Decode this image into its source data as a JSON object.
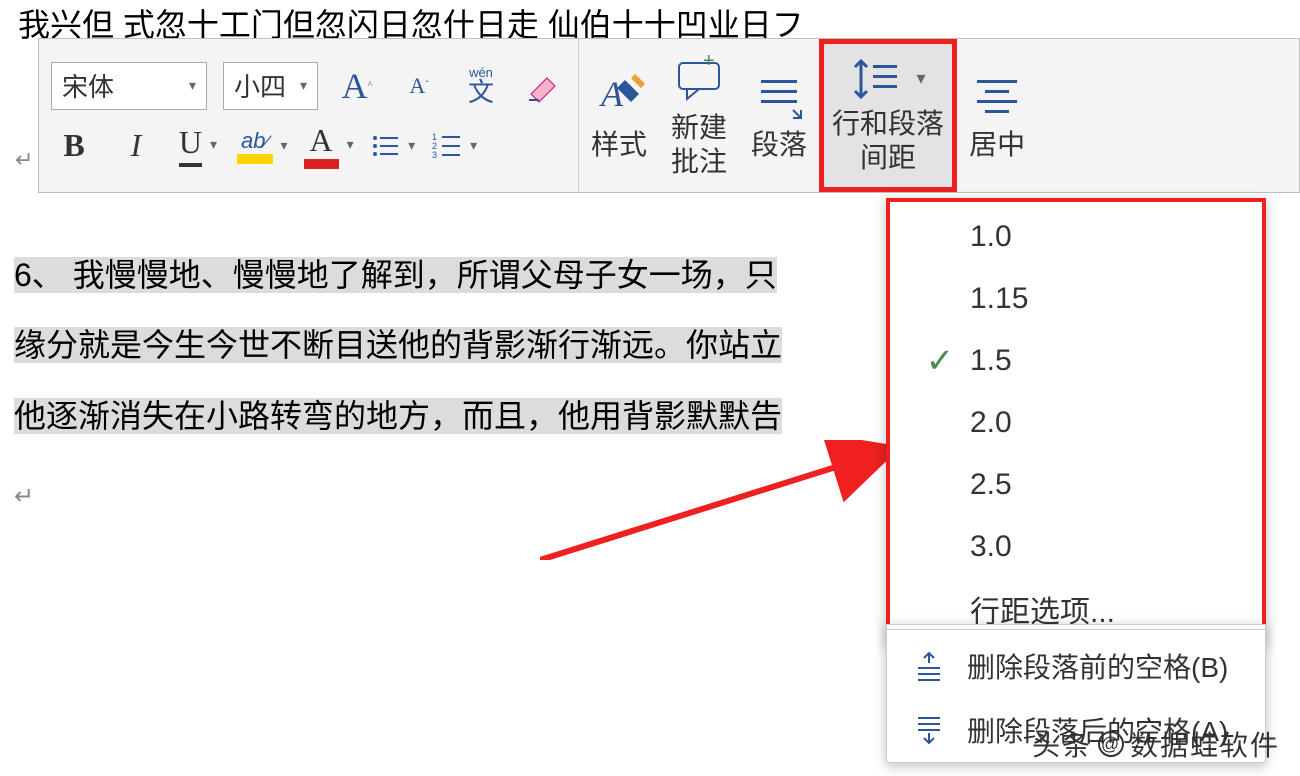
{
  "truncated_text_top": "我兴但  式忽十工门但忽闪日忽什日走  仙伯十十凹业日フ",
  "toolbar": {
    "font_name": "宋体",
    "font_size": "小四",
    "buttons": {
      "grow_font": "A",
      "shrink_font": "A",
      "phonetic": "文",
      "phonetic_ruby": "wén",
      "clear_format": "",
      "bold": "B",
      "italic": "I",
      "underline": "U",
      "highlight": "ab",
      "font_color": "A",
      "styles": "样式",
      "comment": "新建批注",
      "paragraph": "段落",
      "line_spacing": "行和段落间距",
      "center": "居中"
    }
  },
  "document": {
    "line1": "6、  我慢慢地、慢慢地了解到，所谓父母子女一场，只",
    "line2": "缘分就是今生今世不断目送他的背影渐行渐远。你站立",
    "line3": "他逐渐消失在小路转弯的地方，而且，他用背影默默告"
  },
  "dropdown": {
    "options": [
      "1.0",
      "1.15",
      "1.5",
      "2.0",
      "2.5",
      "3.0"
    ],
    "selected": "1.5",
    "more": "行距选项...",
    "remove_before": "删除段落前的空格(B)",
    "remove_after": "删除段落后的空格(A)"
  },
  "watermark": {
    "prefix": "头条",
    "name": "数据蛙软件"
  }
}
